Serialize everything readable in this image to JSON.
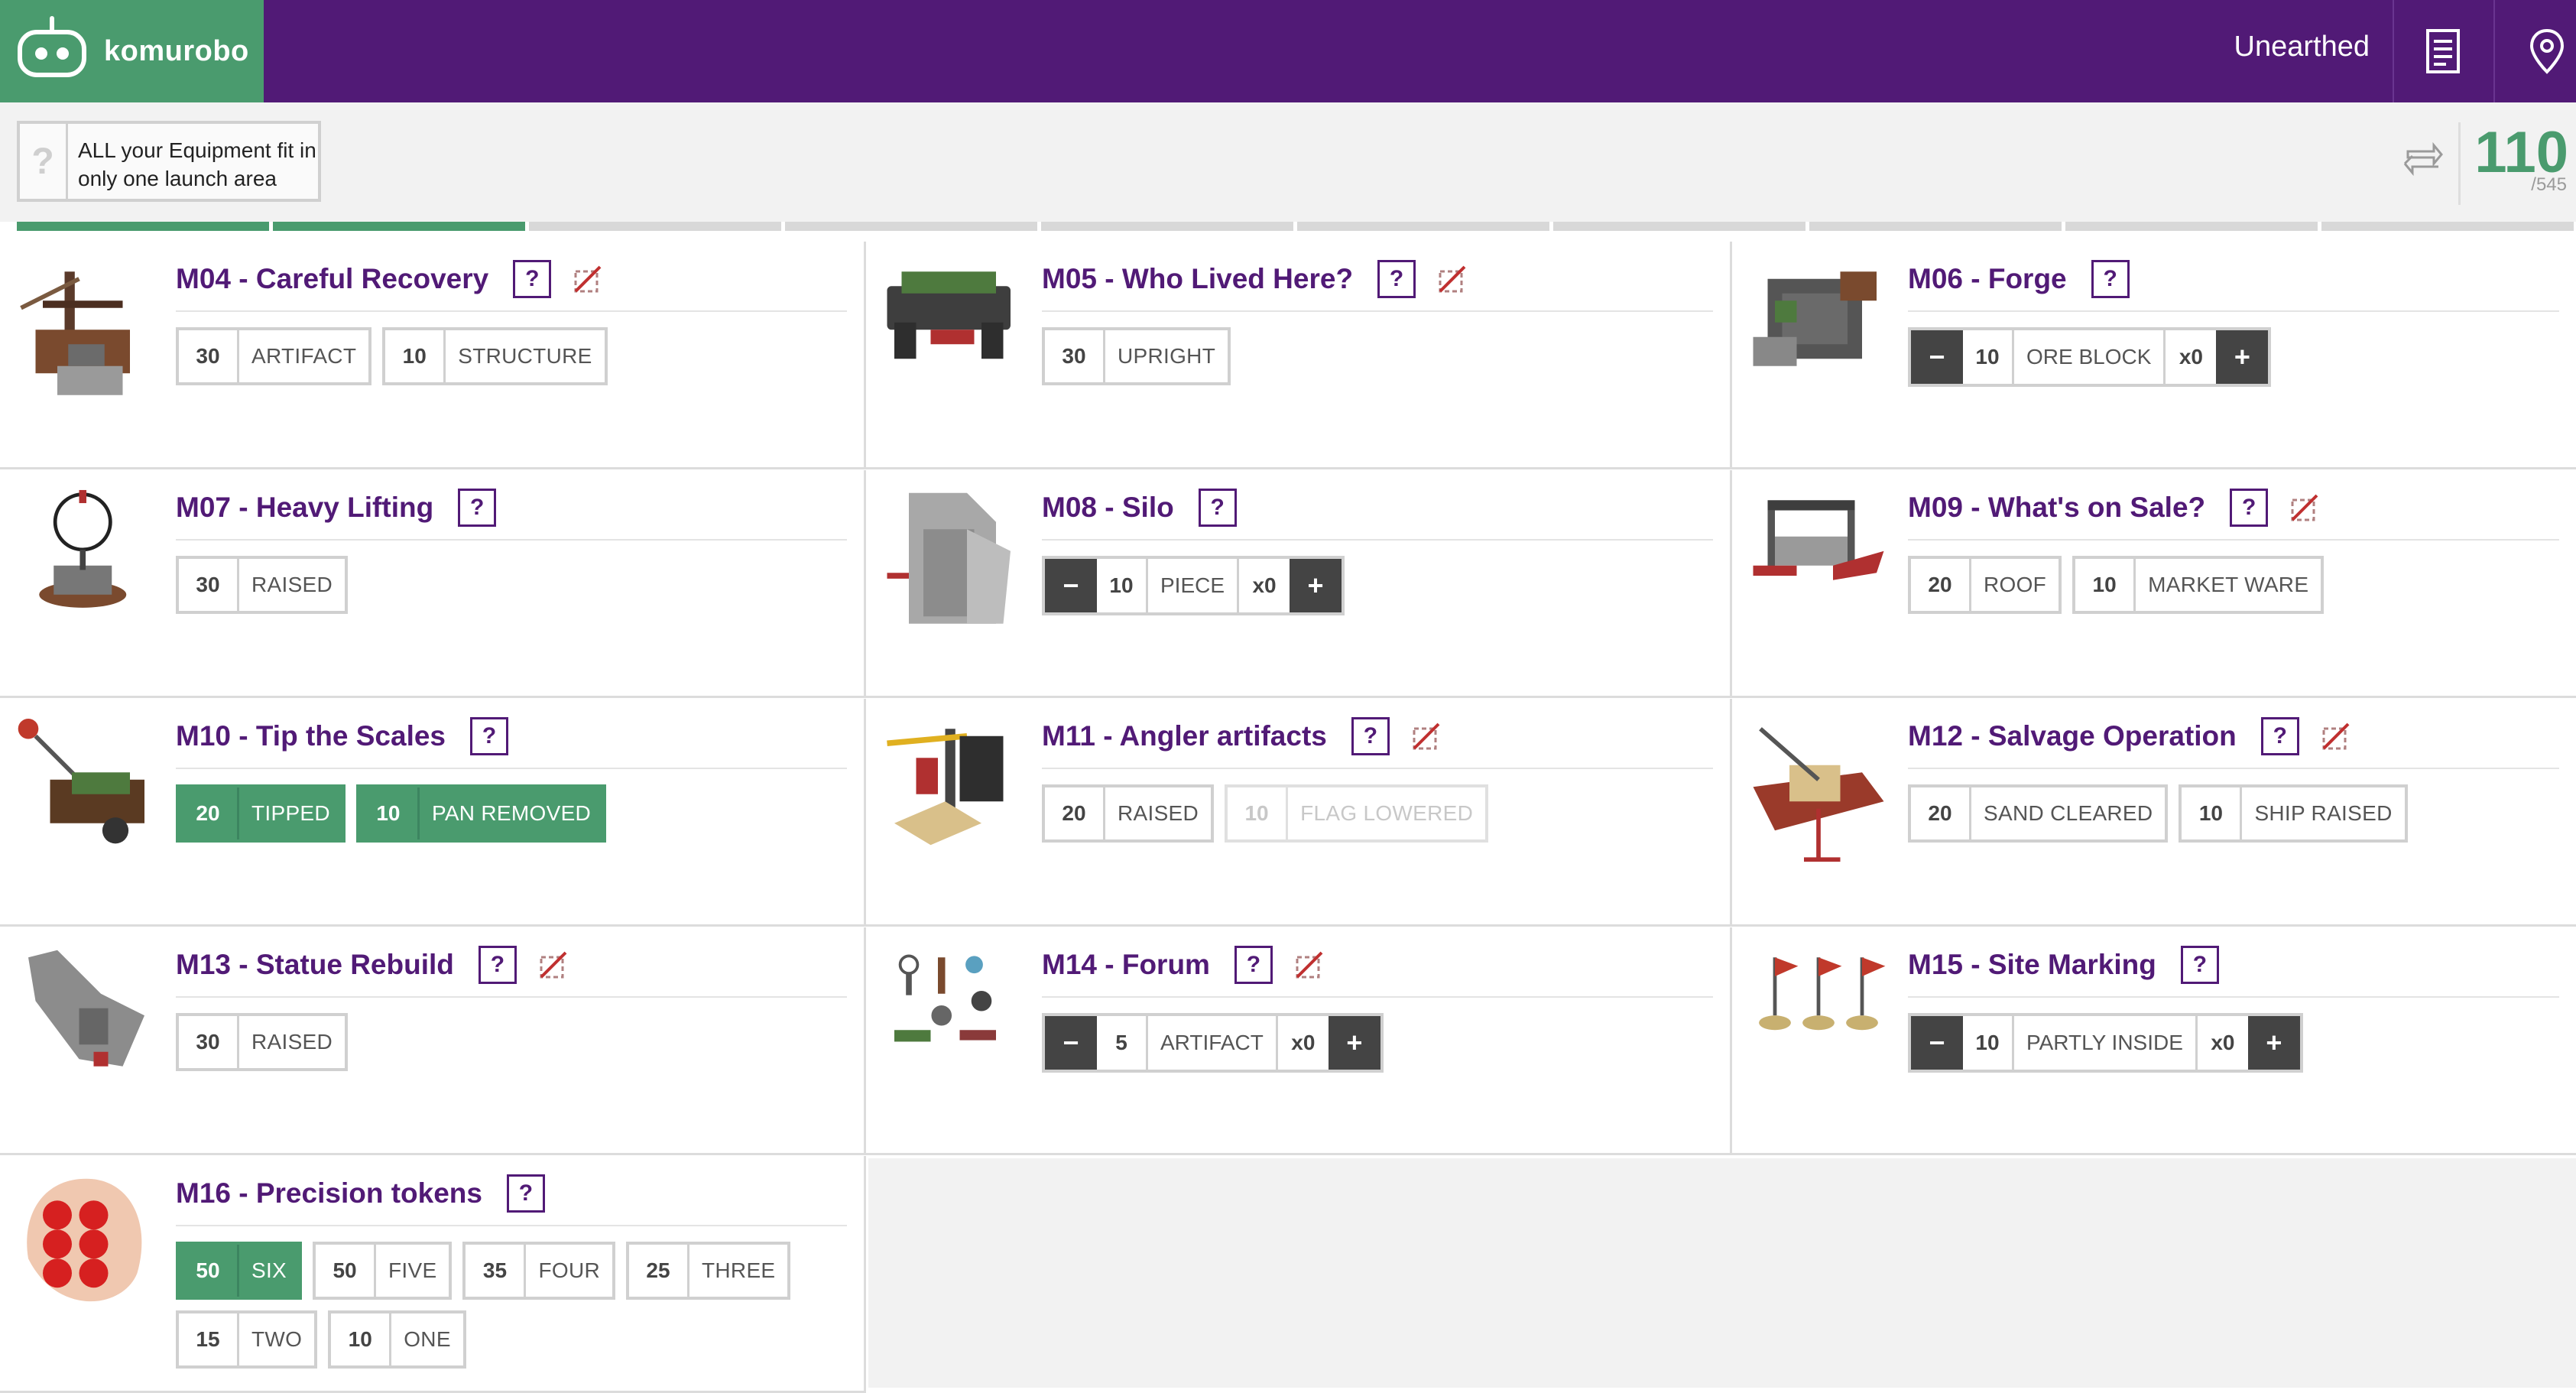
{
  "app": {
    "name": "komurobo",
    "season": "Unearthed"
  },
  "hint": {
    "icon": "question-icon",
    "text": "ALL your Equipment fit in only one launch area"
  },
  "score": {
    "value": "110",
    "max": "/545"
  },
  "progress": {
    "fraction": 0.2
  },
  "colors": {
    "brand": "#511a76",
    "accent": "#4a9b6e",
    "dark": "#444444"
  },
  "missions": [
    {
      "id": "m04",
      "title": "M04 - Careful Recovery",
      "help": "?",
      "no_equipment": true,
      "image": "careful-recovery-model-image",
      "chips": [
        {
          "pts": "30",
          "label": "ARTIFACT"
        },
        {
          "pts": "10",
          "label": "STRUCTURE"
        }
      ]
    },
    {
      "id": "m05",
      "title": "M05 - Who Lived Here?",
      "help": "?",
      "no_equipment": true,
      "image": "who-lived-here-model-image",
      "chips": [
        {
          "pts": "30",
          "label": "UPRIGHT"
        }
      ]
    },
    {
      "id": "m06",
      "title": "M06 - Forge",
      "help": "?",
      "no_equipment": false,
      "image": "forge-model-image",
      "counter": {
        "minus": "−",
        "pts": "10",
        "label": "ORE BLOCK",
        "count": "x0",
        "plus": "+"
      }
    },
    {
      "id": "m07",
      "title": "M07 - Heavy Lifting",
      "help": "?",
      "no_equipment": false,
      "image": "heavy-lifting-model-image",
      "chips": [
        {
          "pts": "30",
          "label": "RAISED"
        }
      ]
    },
    {
      "id": "m08",
      "title": "M08 - Silo",
      "help": "?",
      "no_equipment": false,
      "image": "silo-model-image",
      "counter": {
        "minus": "−",
        "pts": "10",
        "label": "PIECE",
        "count": "x0",
        "plus": "+"
      }
    },
    {
      "id": "m09",
      "title": "M09 - What's on Sale?",
      "help": "?",
      "no_equipment": true,
      "image": "whats-on-sale-model-image",
      "chips": [
        {
          "pts": "20",
          "label": "ROOF"
        },
        {
          "pts": "10",
          "label": "MARKET WARE"
        }
      ]
    },
    {
      "id": "m10",
      "title": "M10 - Tip the Scales",
      "help": "?",
      "no_equipment": false,
      "image": "tip-the-scales-model-image",
      "chips": [
        {
          "pts": "20",
          "label": "TIPPED",
          "state": "on"
        },
        {
          "pts": "10",
          "label": "PAN REMOVED",
          "state": "on"
        }
      ]
    },
    {
      "id": "m11",
      "title": "M11 - Angler artifacts",
      "help": "?",
      "no_equipment": true,
      "image": "angler-artifacts-model-image",
      "chips": [
        {
          "pts": "20",
          "label": "RAISED"
        },
        {
          "pts": "10",
          "label": "FLAG LOWERED",
          "state": "disabled"
        }
      ]
    },
    {
      "id": "m12",
      "title": "M12 - Salvage Operation",
      "help": "?",
      "no_equipment": true,
      "image": "salvage-operation-model-image",
      "chips": [
        {
          "pts": "20",
          "label": "SAND CLEARED"
        },
        {
          "pts": "10",
          "label": "SHIP RAISED"
        }
      ]
    },
    {
      "id": "m13",
      "title": "M13 - Statue Rebuild",
      "help": "?",
      "no_equipment": true,
      "image": "statue-rebuild-model-image",
      "chips": [
        {
          "pts": "30",
          "label": "RAISED"
        }
      ]
    },
    {
      "id": "m14",
      "title": "M14 - Forum",
      "help": "?",
      "no_equipment": true,
      "image": "forum-model-image",
      "counter": {
        "minus": "−",
        "pts": "5",
        "label": "ARTIFACT",
        "count": "x0",
        "plus": "+"
      }
    },
    {
      "id": "m15",
      "title": "M15 - Site Marking",
      "help": "?",
      "no_equipment": false,
      "image": "site-marking-model-image",
      "counter": {
        "minus": "−",
        "pts": "10",
        "label": "PARTLY INSIDE",
        "count": "x0",
        "plus": "+"
      }
    },
    {
      "id": "m16",
      "title": "M16 - Precision tokens",
      "help": "?",
      "no_equipment": false,
      "image": "precision-tokens-model-image",
      "chips": [
        {
          "pts": "50",
          "label": "SIX",
          "state": "on"
        },
        {
          "pts": "50",
          "label": "FIVE"
        },
        {
          "pts": "35",
          "label": "FOUR"
        },
        {
          "pts": "25",
          "label": "THREE"
        },
        {
          "pts": "15",
          "label": "TWO"
        },
        {
          "pts": "10",
          "label": "ONE"
        }
      ]
    }
  ]
}
